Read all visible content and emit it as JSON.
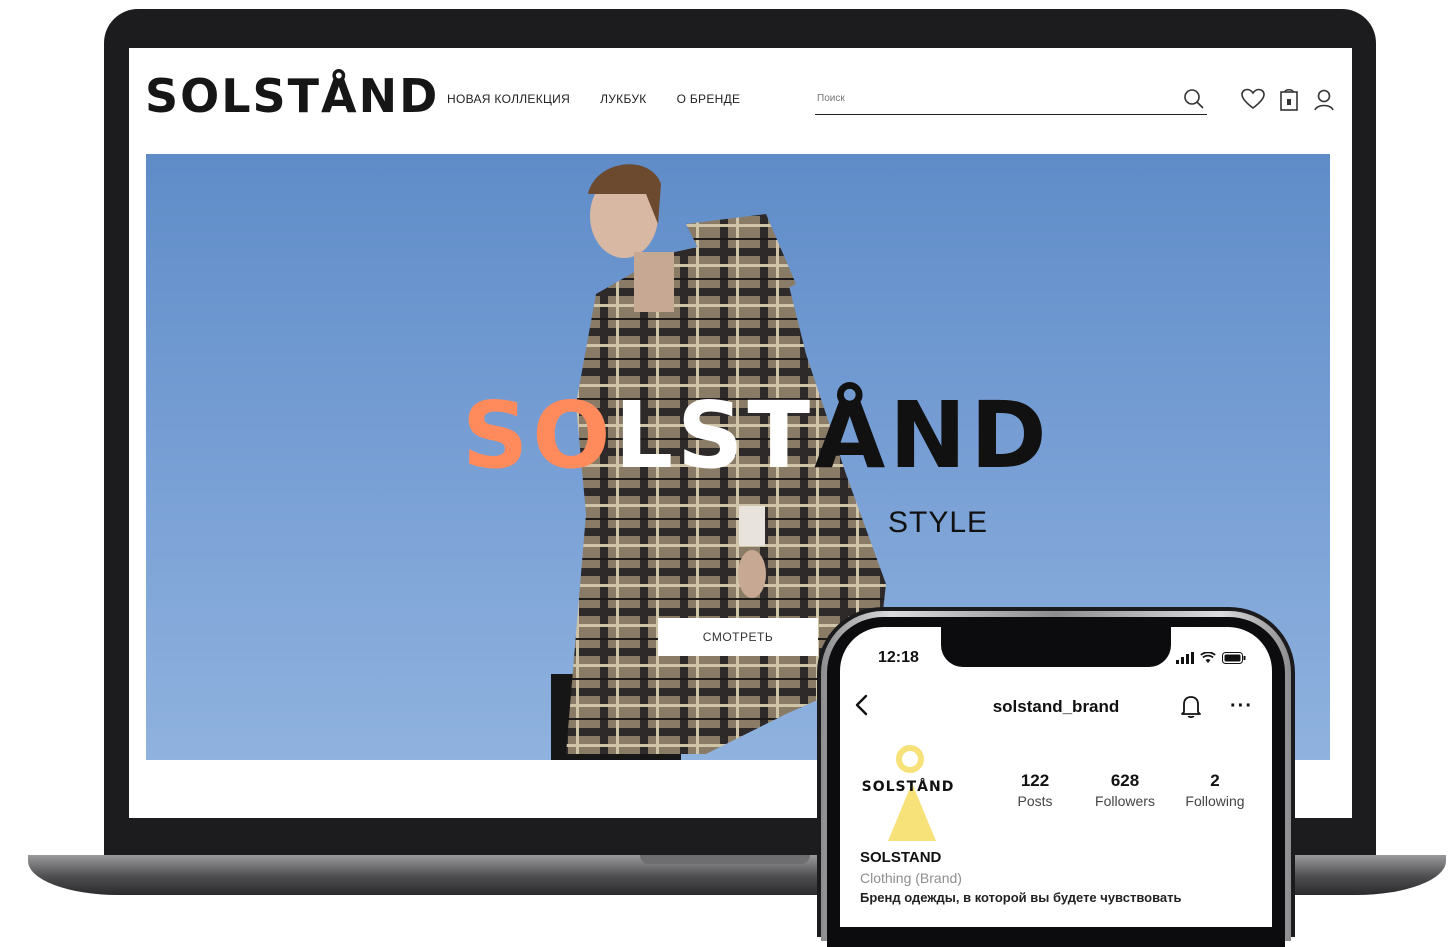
{
  "site": {
    "logo": "SOLSTÅND",
    "nav": [
      "НОВАЯ КОЛЛЕКЦИЯ",
      "ЛУКБУК",
      "О БРЕНДЕ"
    ],
    "search_placeholder": "Поиск",
    "hero": {
      "logo_part1": "SO",
      "logo_part2": "LST",
      "logo_part3": "ÅND",
      "subtitle": "STYLE",
      "cta_label": "СМОТРЕТЬ"
    },
    "icons": [
      "search-icon",
      "heart-icon",
      "bag-icon",
      "user-icon"
    ]
  },
  "phone": {
    "time": "12:18",
    "username": "solstand_brand",
    "more": "···",
    "avatar_text": "SOLSTÅND",
    "stats": [
      {
        "value": "122",
        "label": "Posts"
      },
      {
        "value": "628",
        "label": "Followers"
      },
      {
        "value": "2",
        "label": "Following"
      }
    ],
    "bio_name": "SOLSTAND",
    "bio_category": "Clothing (Brand)",
    "bio_text": "Бренд одежды, в которой вы будете чувствовать"
  },
  "colors": {
    "accent_orange": "#ff8a5c",
    "sky_blue": "#6f98d0",
    "avatar_yellow": "#f7e27a"
  }
}
